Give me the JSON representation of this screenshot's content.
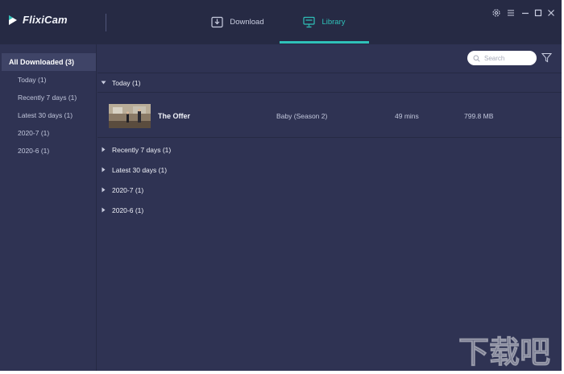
{
  "app": {
    "name": "FlixiCam"
  },
  "nav": {
    "download_label": "Download",
    "library_label": "Library",
    "active": "Library"
  },
  "window_controls": [
    "settings-icon",
    "menu-icon",
    "minimize-icon",
    "maximize-icon",
    "close-icon"
  ],
  "sidebar": {
    "items": [
      {
        "label": "All Downloaded (3)",
        "active": true
      },
      {
        "label": "Today (1)"
      },
      {
        "label": "Recently 7 days (1)"
      },
      {
        "label": "Latest 30 days (1)"
      },
      {
        "label": "2020-7 (1)"
      },
      {
        "label": "2020-6 (1)"
      }
    ]
  },
  "search": {
    "placeholder": "Search",
    "value": ""
  },
  "groups": [
    {
      "label": "Today (1)",
      "expanded": true
    },
    {
      "label": "Recently 7 days (1)",
      "expanded": false
    },
    {
      "label": "Latest 30 days (1)",
      "expanded": false
    },
    {
      "label": "2020-7 (1)",
      "expanded": false
    },
    {
      "label": "2020-6 (1)",
      "expanded": false
    }
  ],
  "video": {
    "title": "The Offer",
    "series": "Baby (Season 2)",
    "duration": "49 mins",
    "size": "799.8 MB"
  },
  "watermark": {
    "text": "下载吧"
  },
  "colors": {
    "accent": "#2fc1b9",
    "titlebar_bg": "#262a44",
    "body_bg": "#2f3353",
    "active_item_bg": "#3f4467"
  }
}
